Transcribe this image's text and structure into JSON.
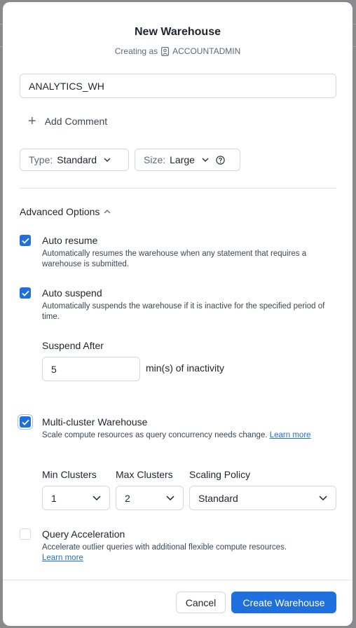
{
  "dialog": {
    "title": "New Warehouse",
    "creating_as_prefix": "Creating as",
    "role": "ACCOUNTADMIN"
  },
  "name_input": {
    "value": "ANALYTICS_WH"
  },
  "add_comment": {
    "label": "Add Comment"
  },
  "type_select": {
    "label": "Type:",
    "value": "Standard"
  },
  "size_select": {
    "label": "Size:",
    "value": "Large"
  },
  "advanced": {
    "label": "Advanced Options"
  },
  "auto_resume": {
    "checked": true,
    "title": "Auto resume",
    "description": "Automatically resumes the warehouse when any statement that requires a warehouse is submitted."
  },
  "auto_suspend": {
    "checked": true,
    "title": "Auto suspend",
    "description": "Automatically suspends the warehouse if it is inactive for the specified period of time.",
    "suspend_after_label": "Suspend After",
    "suspend_after_value": "5",
    "unit": "min(s) of inactivity"
  },
  "multi_cluster": {
    "checked": true,
    "title": "Multi-cluster Warehouse",
    "description": "Scale compute resources as query concurrency needs change.",
    "link": "Learn more",
    "min_label": "Min Clusters",
    "min_value": "1",
    "max_label": "Max Clusters",
    "max_value": "2",
    "policy_label": "Scaling Policy",
    "policy_value": "Standard"
  },
  "query_acceleration": {
    "checked": false,
    "title": "Query Acceleration",
    "description": "Accelerate outlier queries with additional flexible compute resources.",
    "link": "Learn more"
  },
  "footer": {
    "cancel": "Cancel",
    "create": "Create Warehouse"
  },
  "colors": {
    "accent": "#1f6fde",
    "text": "#1e252d",
    "muted": "#5d6a78",
    "border": "#d5d9de"
  }
}
